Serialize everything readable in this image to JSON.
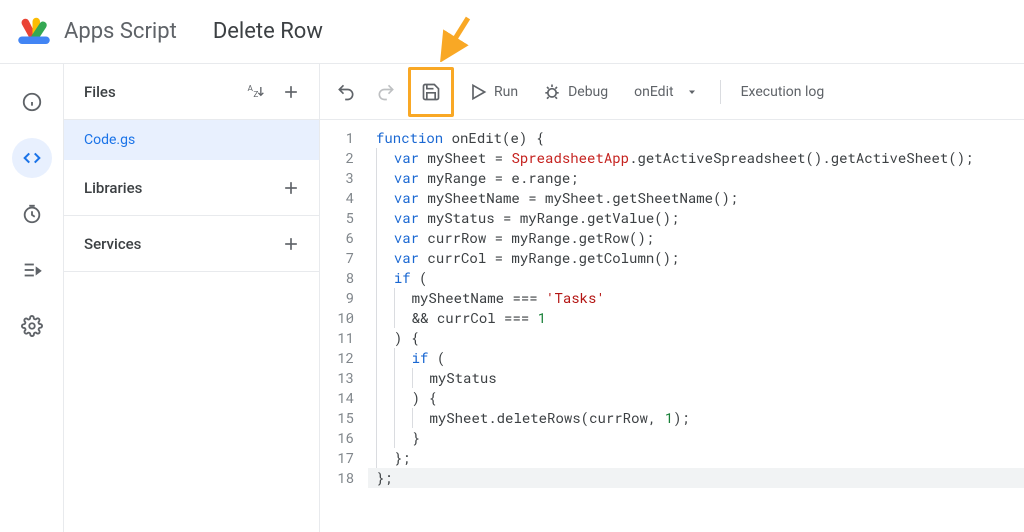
{
  "header": {
    "app_name": "Apps Script",
    "project_name": "Delete Row"
  },
  "nav_rail": {
    "items": [
      {
        "name": "overview-icon",
        "active": false
      },
      {
        "name": "editor-icon",
        "active": true
      },
      {
        "name": "triggers-icon",
        "active": false
      },
      {
        "name": "executions-icon",
        "active": false
      },
      {
        "name": "settings-icon",
        "active": false
      }
    ]
  },
  "sidebar": {
    "files": {
      "title": "Files",
      "items": [
        "Code.gs"
      ]
    },
    "libraries": {
      "title": "Libraries"
    },
    "services": {
      "title": "Services"
    }
  },
  "toolbar": {
    "run_label": "Run",
    "debug_label": "Debug",
    "func_selected": "onEdit",
    "exec_log_label": "Execution log"
  },
  "annotation": {
    "highlight_target": "save-button",
    "color": "#f9a825"
  },
  "editor": {
    "line_count": 18,
    "cursor_line": 18,
    "code_lines": [
      [
        {
          "t": "function ",
          "c": "kw"
        },
        {
          "t": "onEdit",
          "c": "fn"
        },
        {
          "t": "(e) {",
          "c": ""
        }
      ],
      [
        {
          "t": "  ",
          "c": ""
        },
        {
          "t": "var ",
          "c": "kw"
        },
        {
          "t": "mySheet = ",
          "c": ""
        },
        {
          "t": "SpreadsheetApp",
          "c": "cls"
        },
        {
          "t": ".getActiveSpreadsheet().getActiveSheet();",
          "c": ""
        }
      ],
      [
        {
          "t": "  ",
          "c": ""
        },
        {
          "t": "var ",
          "c": "kw"
        },
        {
          "t": "myRange = e.range;",
          "c": ""
        }
      ],
      [
        {
          "t": "  ",
          "c": ""
        },
        {
          "t": "var ",
          "c": "kw"
        },
        {
          "t": "mySheetName = mySheet.getSheetName();",
          "c": ""
        }
      ],
      [
        {
          "t": "  ",
          "c": ""
        },
        {
          "t": "var ",
          "c": "kw"
        },
        {
          "t": "myStatus = myRange.getValue();",
          "c": ""
        }
      ],
      [
        {
          "t": "  ",
          "c": ""
        },
        {
          "t": "var ",
          "c": "kw"
        },
        {
          "t": "currRow = myRange.getRow();",
          "c": ""
        }
      ],
      [
        {
          "t": "  ",
          "c": ""
        },
        {
          "t": "var ",
          "c": "kw"
        },
        {
          "t": "currCol = myRange.getColumn();",
          "c": ""
        }
      ],
      [
        {
          "t": "  ",
          "c": ""
        },
        {
          "t": "if ",
          "c": "kw"
        },
        {
          "t": "(",
          "c": ""
        }
      ],
      [
        {
          "t": "    mySheetName === ",
          "c": ""
        },
        {
          "t": "'Tasks'",
          "c": "str"
        }
      ],
      [
        {
          "t": "    && currCol === ",
          "c": ""
        },
        {
          "t": "1",
          "c": "num"
        }
      ],
      [
        {
          "t": "  ) {",
          "c": ""
        }
      ],
      [
        {
          "t": "    ",
          "c": ""
        },
        {
          "t": "if ",
          "c": "kw"
        },
        {
          "t": "(",
          "c": ""
        }
      ],
      [
        {
          "t": "      myStatus",
          "c": ""
        }
      ],
      [
        {
          "t": "    ) {",
          "c": ""
        }
      ],
      [
        {
          "t": "      mySheet.deleteRows(currRow, ",
          "c": ""
        },
        {
          "t": "1",
          "c": "num"
        },
        {
          "t": ");",
          "c": ""
        }
      ],
      [
        {
          "t": "    }",
          "c": ""
        }
      ],
      [
        {
          "t": "  };",
          "c": ""
        }
      ],
      [
        {
          "t": "};",
          "c": ""
        }
      ]
    ]
  }
}
